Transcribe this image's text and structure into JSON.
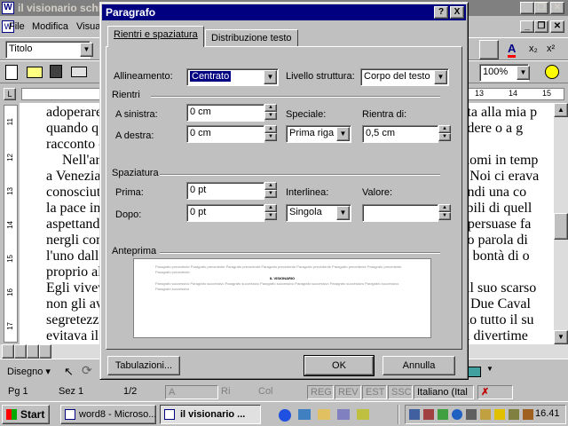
{
  "word_window": {
    "title": "il visionario schi",
    "menu": [
      "File",
      "Modifica",
      "Visua"
    ],
    "style_box": "Titolo",
    "zoom": "100%",
    "ruler_right_marks": [
      "13",
      "14",
      "15"
    ],
    "doc_lines": [
      "adoperare",
      "quando q",
      "racconto c",
      "Nell'ar",
      "a Venezia",
      "conosciut",
      "la pace in",
      "aspettando",
      "nergli con",
      "l'uno dall",
      "proprio al",
      "Egli viveva",
      "non gli av",
      "segretezza",
      "evitava il"
    ],
    "doc_lines_right": [
      "corta alla mia p",
      "perdere o a g",
      "",
      "andomi in temp",
      "va. Noi ci erava",
      "quindi una co",
      "rcabili di quell",
      "mi persuase fa",
      "nmo parola di",
      "e la bontà di o",
      "",
      "ed il suo scarso",
      "go. Due Caval",
      "vano tutto il su",
      "va i divertime"
    ],
    "vertical_ruler": [
      "11",
      "12",
      "13",
      "14",
      "15",
      "16",
      "17"
    ],
    "draw_toolbar": "Disegno"
  },
  "status_bar": {
    "page": "Pg 1",
    "section": "Sez 1",
    "pages": "1/2",
    "at": "A",
    "ri": "Ri",
    "col": "Col",
    "reg": "REG",
    "rev": "REV",
    "est": "EST",
    "ssc": "SSC",
    "language": "Italiano (Ital"
  },
  "taskbar": {
    "start": "Start",
    "tasks": [
      "word8 - Microso...",
      "il visionario ..."
    ],
    "clock": "16.41"
  },
  "dialog": {
    "title": "Paragrafo",
    "help_btn": "?",
    "close_btn": "X",
    "tabs": [
      "Rientri e spaziatura",
      "Distribuzione testo"
    ],
    "alignment_label": "Allineamento:",
    "alignment_value": "Centrato",
    "outline_label": "Livello struttura:",
    "outline_value": "Corpo del testo",
    "indent_group": "Rientri",
    "left_label": "A sinistra:",
    "left_value": "0 cm",
    "right_label": "A destra:",
    "right_value": "0 cm",
    "special_label": "Speciale:",
    "special_value": "Prima riga",
    "by_label": "Rientra di:",
    "by_value": "0,5 cm",
    "spacing_group": "Spaziatura",
    "before_label": "Prima:",
    "before_value": "0 pt",
    "after_label": "Dopo:",
    "after_value": "0 pt",
    "line_label": "Interlinea:",
    "line_value": "Singola",
    "at_label": "Valore:",
    "at_value": "",
    "preview_group": "Anteprima",
    "preview_prev_text": "Paragrafo precedente Paragrafo precedente Paragrafo precedente Paragrafo precedente Paragrafo precedente Paragrafo precedente Paragrafo precedente Paragrafo precedente",
    "preview_title": "IL VISIONARIO",
    "preview_next_text": "Paragrafo successivo Paragrafo successivo Paragrafo successivo Paragrafo successivo Paragrafo successivo Paragrafo successivo Paragrafo successivo Paragrafo successivo",
    "tabs_button": "Tabulazioni...",
    "ok_button": "OK",
    "cancel_button": "Annulla"
  }
}
